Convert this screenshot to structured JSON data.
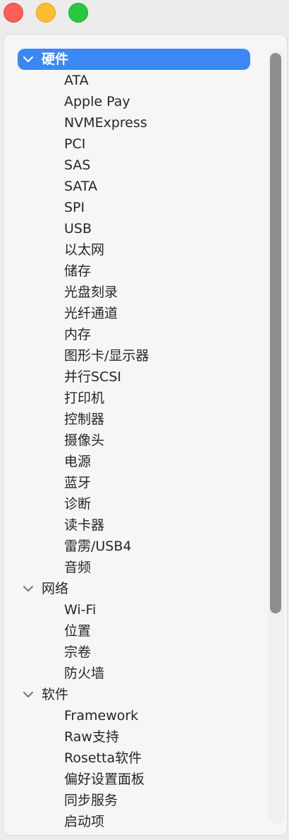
{
  "window": {
    "colors": {
      "close": "#fe5f57",
      "minimize": "#febc2e",
      "maximize": "#28c840",
      "selection": "#3b87f5"
    }
  },
  "sidebar": {
    "categories": [
      {
        "label": "硬件",
        "expanded": true,
        "selected": true,
        "items": [
          "ATA",
          "Apple Pay",
          "NVMExpress",
          "PCI",
          "SAS",
          "SATA",
          "SPI",
          "USB",
          "以太网",
          "储存",
          "光盘刻录",
          "光纤通道",
          "内存",
          "图形卡/显示器",
          "并行SCSI",
          "打印机",
          "控制器",
          "摄像头",
          "电源",
          "蓝牙",
          "诊断",
          "读卡器",
          "雷雳/USB4",
          "音频"
        ]
      },
      {
        "label": "网络",
        "expanded": true,
        "selected": false,
        "items": [
          "Wi-Fi",
          "位置",
          "宗卷",
          "防火墙"
        ]
      },
      {
        "label": "软件",
        "expanded": true,
        "selected": false,
        "items": [
          "Framework",
          "Raw支持",
          "Rosetta软件",
          "偏好设置面板",
          "同步服务",
          "启动项"
        ]
      }
    ]
  }
}
